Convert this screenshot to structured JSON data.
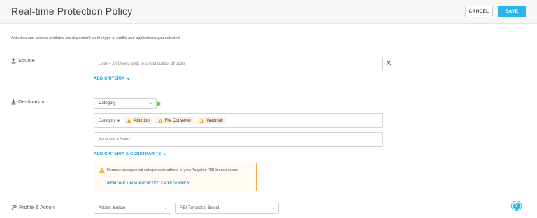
{
  "header": {
    "title": "Real-time Protection Policy",
    "cancel_label": "CANCEL",
    "save_label": "SAVE"
  },
  "info_text": "Activities and actions available are dependent on the type of profile and applications you selected.",
  "source": {
    "label": "Source",
    "users_field": "User = All Users: click to select subset of users",
    "add_criteria": "ADD CRITERIA"
  },
  "destination": {
    "label": "Destination",
    "type_select": "Category",
    "category_prefix": "Category",
    "categories": [
      "Abortion",
      "File Converter",
      "Webmail"
    ],
    "activities_field": "Activities = Select",
    "add_criteria_constraints": "ADD CRITERIA & CONSTRAINTS"
  },
  "warning": {
    "message": "Remove unsupported categories to adhere to your Targeted RBI license scope.",
    "action": "REMOVE UNSUPPORTED CATEGORIES"
  },
  "profile_action": {
    "label": "Profile & Action",
    "action_prefix": "Action:",
    "action_value": "Isolate",
    "template_prefix": "RBI Template:",
    "template_value": "Select"
  },
  "help_label": "?",
  "colors": {
    "accent": "#2cb5e8",
    "link": "#1a98d5",
    "warning_border": "#f0a64a",
    "warning_icon": "#f39c12",
    "chip_bg": "#fff2e0",
    "status_green": "#63c04d"
  },
  "icons": {
    "source": "user-upload-icon",
    "destination": "destination-icon",
    "profile": "tools-icon",
    "close": "close-icon",
    "warning": "warning-triangle-icon",
    "help": "help-icon"
  }
}
